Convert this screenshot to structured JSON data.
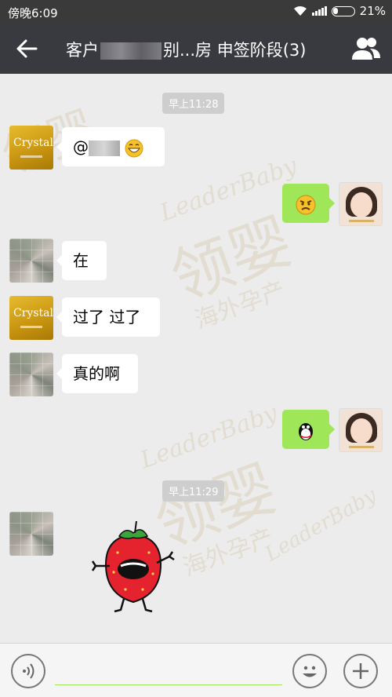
{
  "status_bar": {
    "time": "傍晚6:09",
    "battery": "21%"
  },
  "header": {
    "title_prefix": "客户",
    "title_suffix": "别...房 申签阶段(3)"
  },
  "watermark": {
    "brand_en": "LeaderBaby",
    "brand_cn": "领婴",
    "tagline": "海外孕产"
  },
  "messages": [
    {
      "type": "timestamp",
      "text": "早上11:28"
    },
    {
      "type": "text",
      "side": "left",
      "sender": "crystal",
      "prefix": "@",
      "emoji": "grinning-face"
    },
    {
      "type": "emoji",
      "side": "right",
      "sender": "me",
      "emoji": "angry-face"
    },
    {
      "type": "text",
      "side": "left",
      "sender": "customer",
      "text": "在"
    },
    {
      "type": "text",
      "side": "left",
      "sender": "crystal",
      "text": "过了 过了"
    },
    {
      "type": "text",
      "side": "left",
      "sender": "customer",
      "text": "真的啊"
    },
    {
      "type": "emoji",
      "side": "right",
      "sender": "me",
      "emoji": "penguin-face"
    },
    {
      "type": "timestamp",
      "text": "早上11:29"
    },
    {
      "type": "sticker",
      "side": "left",
      "sender": "customer",
      "sticker": "dancing-strawberry"
    }
  ],
  "avatars": {
    "crystal_label": "Crystal"
  },
  "input_bar": {
    "voice_icon": "voice-icon",
    "emoji_icon": "emoji-icon",
    "plus_icon": "plus-icon",
    "accent_color": "#9fe658"
  },
  "colors": {
    "header_bg": "#393a3f",
    "chat_bg": "#ececec",
    "my_bubble": "#9fe658"
  }
}
